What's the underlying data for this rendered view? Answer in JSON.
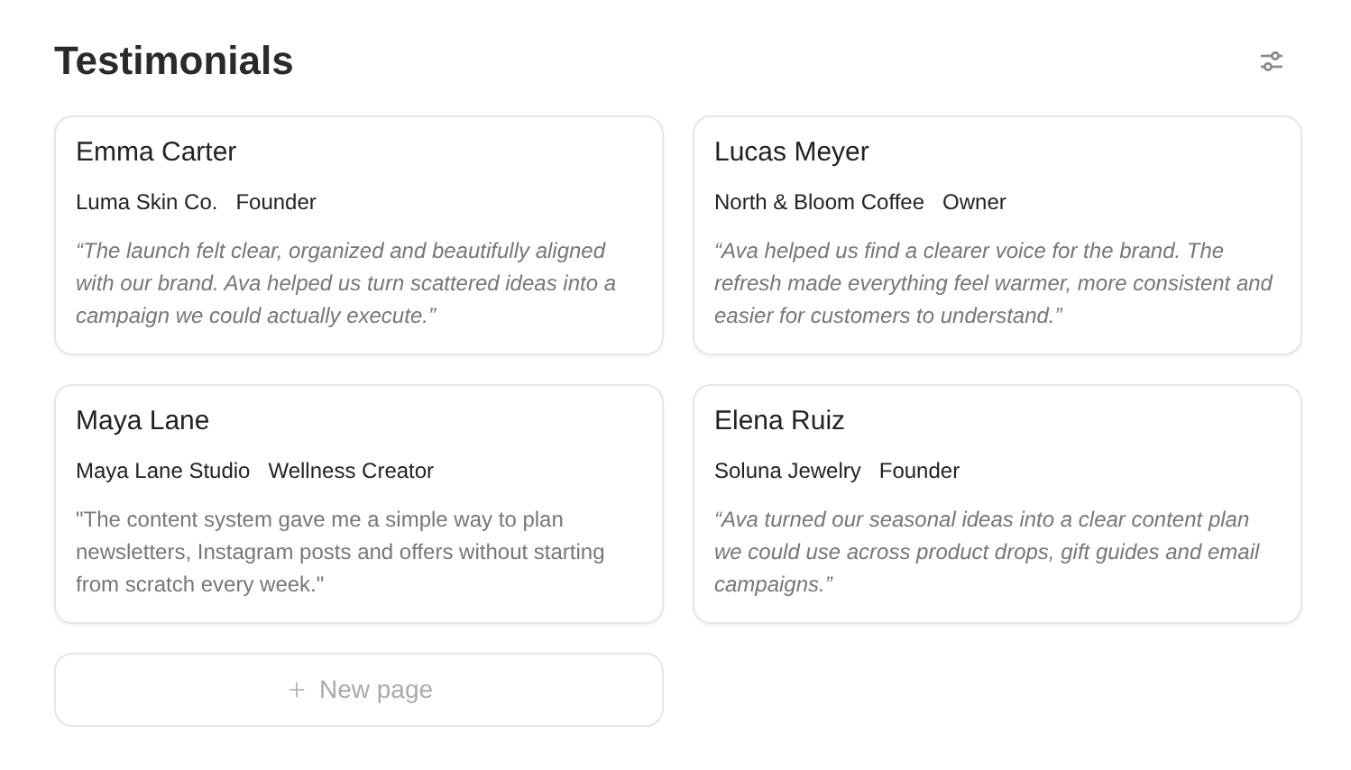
{
  "title": "Testimonials",
  "cards": [
    {
      "name": "Emma Carter",
      "company": "Luma Skin Co.",
      "role": "Founder",
      "quote": "“The launch felt clear, organized and beautifully aligned with our brand. Ava helped us turn scattered ideas into a campaign we could actually execute.”",
      "italic": true
    },
    {
      "name": "Lucas Meyer",
      "company": "North & Bloom Coffee",
      "role": "Owner",
      "quote": "“Ava helped us find a clearer voice for the brand. The refresh made everything feel warmer, more consistent and easier for customers to understand.”",
      "italic": true
    },
    {
      "name": "Maya Lane",
      "company": "Maya Lane Studio",
      "role": "Wellness Creator",
      "quote": "\"The content system gave me a simple way to plan newsletters, Instagram posts and offers without starting from scratch every week.\"",
      "italic": false
    },
    {
      "name": "Elena Ruiz",
      "company": "Soluna Jewelry",
      "role": "Founder",
      "quote": "“Ava turned our seasonal ideas into a clear content plan we could use across product drops, gift guides and email campaigns.”",
      "italic": true
    }
  ],
  "new_page": {
    "label": "New page"
  }
}
